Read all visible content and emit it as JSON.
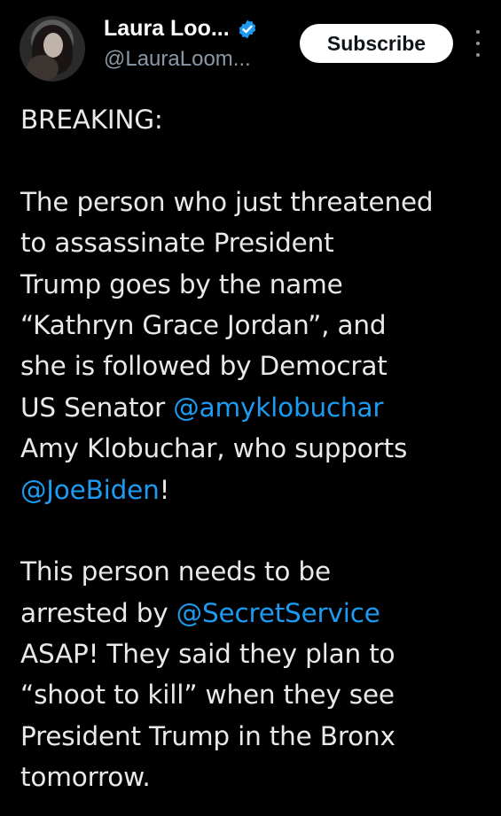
{
  "author": {
    "display_name": "Laura Loo...",
    "handle": "@LauraLoom...",
    "verified_icon": "verified-badge-icon",
    "verified_color": "#1d9bf0"
  },
  "actions": {
    "subscribe_label": "Subscribe",
    "more_icon": "more-vertical-icon"
  },
  "colors": {
    "background": "#000000",
    "text": "#e7e9ea",
    "secondary_text": "#8b98a5",
    "mention": "#1d9bf0"
  },
  "post": {
    "lines": [
      [
        {
          "t": "BREAKING:"
        }
      ],
      [
        {
          "t": ""
        }
      ],
      [
        {
          "t": "The person who just threatened"
        }
      ],
      [
        {
          "t": "to assassinate President"
        }
      ],
      [
        {
          "t": "Trump goes by the name"
        }
      ],
      [
        {
          "t": "“Kathryn Grace Jordan”, and"
        }
      ],
      [
        {
          "t": "she is followed by Democrat"
        }
      ],
      [
        {
          "t": "US Senator "
        },
        {
          "t": "@amyklobuchar",
          "m": true
        }
      ],
      [
        {
          "t": "Amy Klobuchar, who supports"
        }
      ],
      [
        {
          "t": "@JoeBiden",
          "m": true
        },
        {
          "t": "!"
        }
      ],
      [
        {
          "t": ""
        }
      ],
      [
        {
          "t": "This person needs to be"
        }
      ],
      [
        {
          "t": "arrested by "
        },
        {
          "t": "@SecretService",
          "m": true
        }
      ],
      [
        {
          "t": "ASAP! They said they plan to"
        }
      ],
      [
        {
          "t": "“shoot to kill” when they see"
        }
      ],
      [
        {
          "t": "President Trump in the Bronx"
        }
      ],
      [
        {
          "t": "tomorrow."
        }
      ]
    ]
  }
}
